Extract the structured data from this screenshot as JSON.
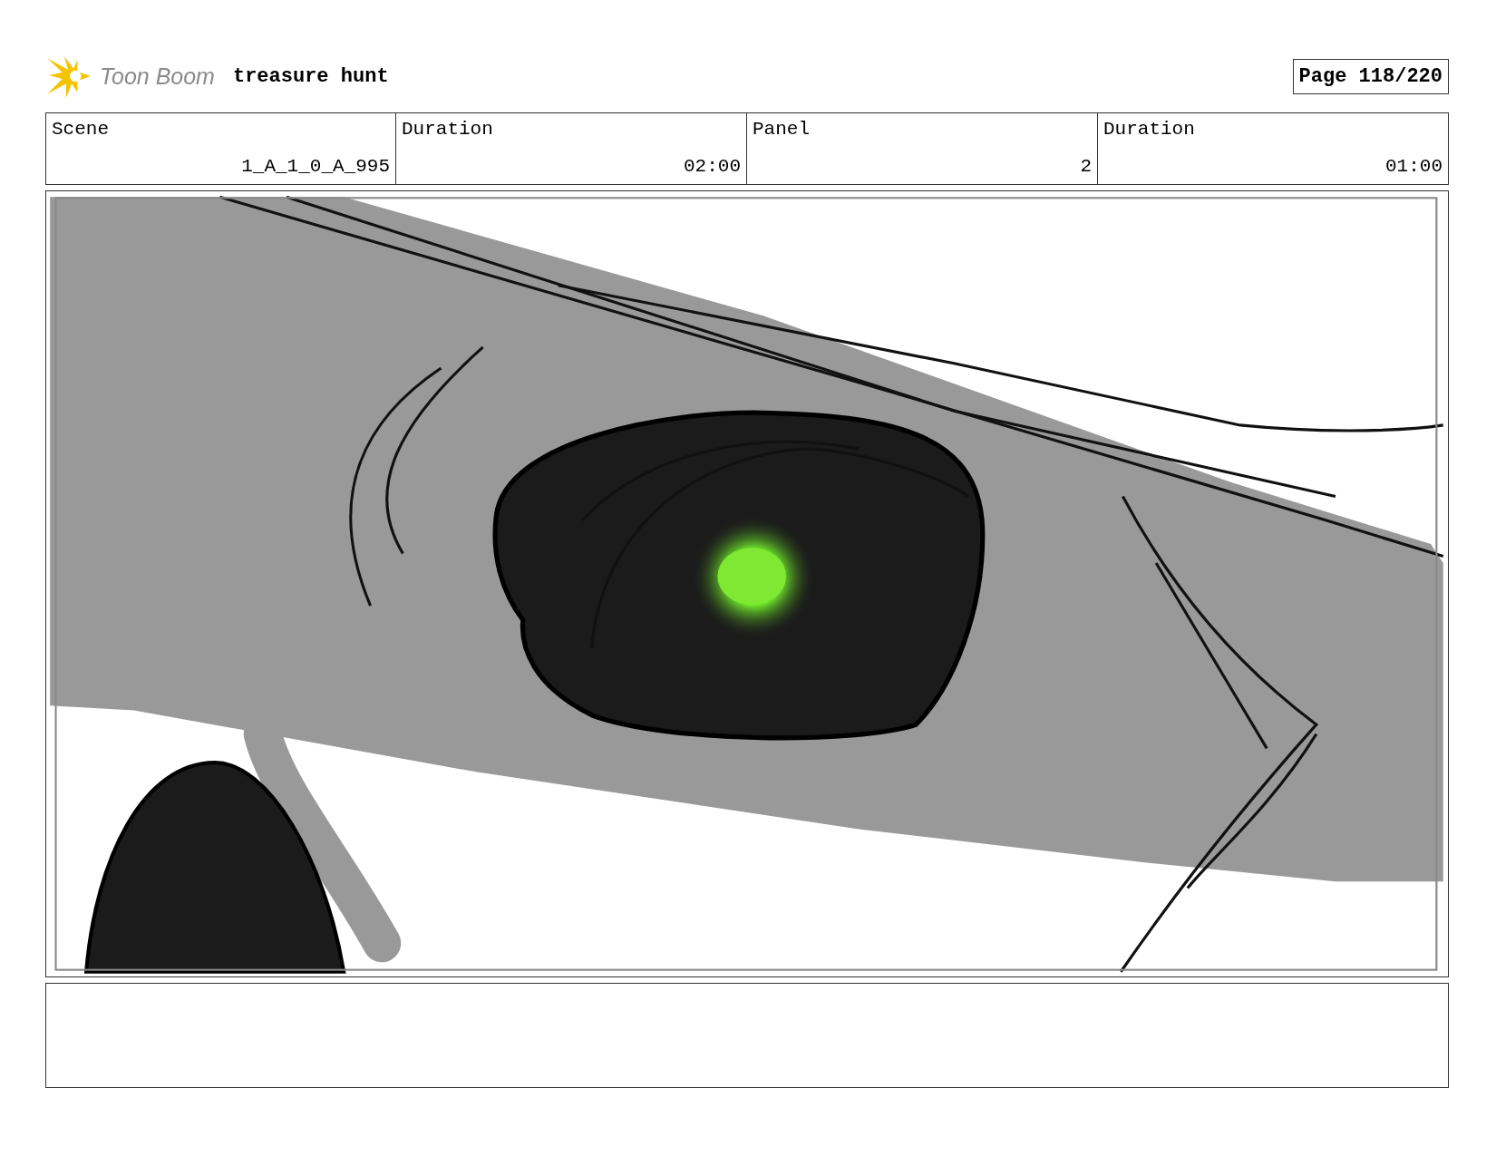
{
  "header": {
    "logo_text": "Toon Boom",
    "title": "treasure hunt",
    "page": "Page 118/220"
  },
  "info_table": {
    "columns": [
      "Scene",
      "Duration",
      "Panel",
      "Duration"
    ],
    "rows": [
      [
        "1_A_1_0_A_995",
        "02:00",
        "2",
        "01:00"
      ]
    ]
  }
}
